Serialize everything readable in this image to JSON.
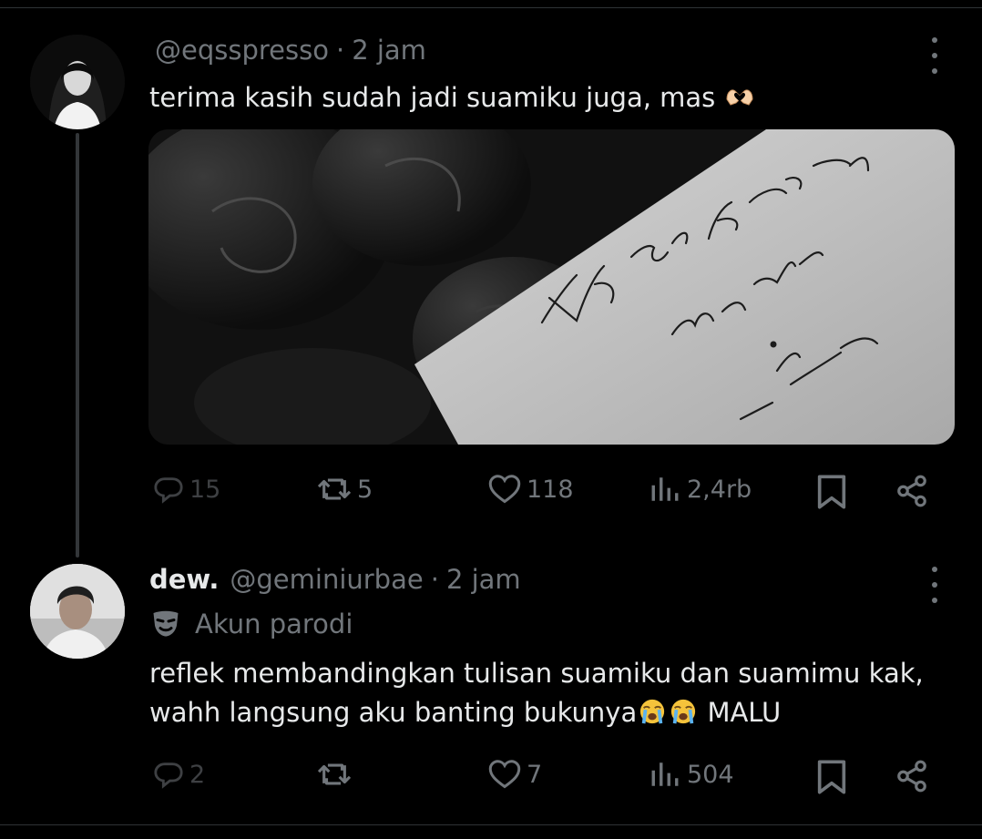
{
  "tweets": [
    {
      "display_name": "",
      "handle": "@eqsspresso",
      "separator": "·",
      "time": "2 jam",
      "text": "terima kasih sudah jadi suamiku juga, mas",
      "emoji": "heart-hands-emoji",
      "media_handwriting": [
        "Thank you for being",
        "my wife.",
        "— Papa"
      ],
      "actions": {
        "replies": "15",
        "reposts": "5",
        "likes": "118",
        "views": "2,4rb"
      }
    },
    {
      "display_name": "dew.",
      "handle": "@geminiurbae",
      "separator": "·",
      "time": "2 jam",
      "badge": "Akun parodi",
      "text_line1": "reflek membandingkan tulisan suamiku dan suamimu kak,",
      "text_line2": "wahh langsung aku banting bukunya",
      "text_line2_end": " MALU",
      "emoji": "loudly-crying-face-emoji",
      "actions": {
        "replies": "2",
        "reposts": "",
        "likes": "7",
        "views": "504"
      }
    }
  ],
  "colors": {
    "background": "#000000",
    "text": "#e7e9ea",
    "muted": "#71767b",
    "divider": "#2f3336"
  }
}
